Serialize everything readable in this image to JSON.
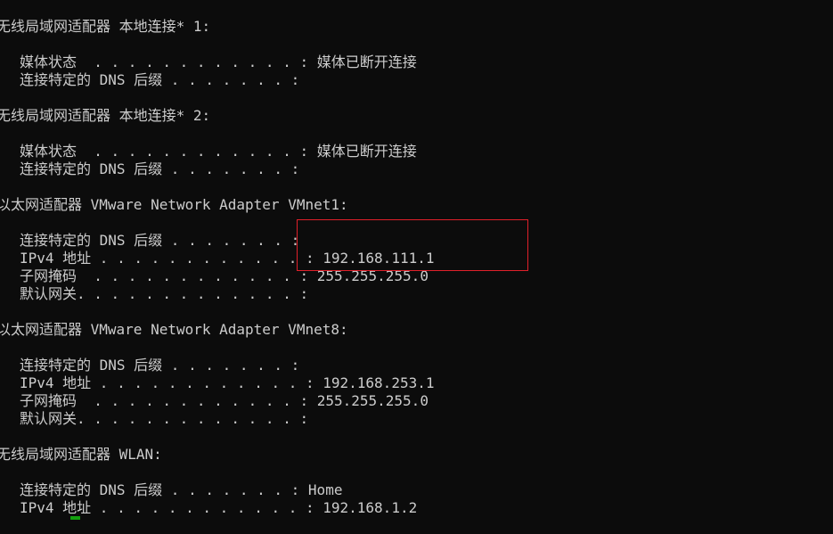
{
  "terminal": {
    "lines": [
      "无线局域网适配器 本地连接* 1:",
      "媒体状态  . . . . . . . . . . . . : 媒体已断开连接",
      "连接特定的 DNS 后缀 . . . . . . . :",
      "无线局域网适配器 本地连接* 2:",
      "媒体状态  . . . . . . . . . . . . : 媒体已断开连接",
      "连接特定的 DNS 后缀 . . . . . . . :",
      "以太网适配器 VMware Network Adapter VMnet1:",
      "连接特定的 DNS 后缀 . . . . . . . :",
      "IPv4 地址 . . . . . . . . . . . . : 192.168.111.1",
      "子网掩码  . . . . . . . . . . . . : 255.255.255.0",
      "默认网关. . . . . . . . . . . . . :",
      "以太网适配器 VMware Network Adapter VMnet8:",
      "连接特定的 DNS 后缀 . . . . . . . :",
      "IPv4 地址 . . . . . . . . . . . . : 192.168.253.1",
      "子网掩码  . . . . . . . . . . . . : 255.255.255.0",
      "默认网关. . . . . . . . . . . . . :",
      "无线局域网适配器 WLAN:",
      "连接特定的 DNS 后缀 . . . . . . . : Home",
      "IPv4 地址 . . . . . . . . . . . . : 192.168.1.2"
    ]
  },
  "colors": {
    "background": "#0c0c0c",
    "text": "#cccccc",
    "highlight_box": "#e0202a",
    "cursor": "#13a10e"
  }
}
